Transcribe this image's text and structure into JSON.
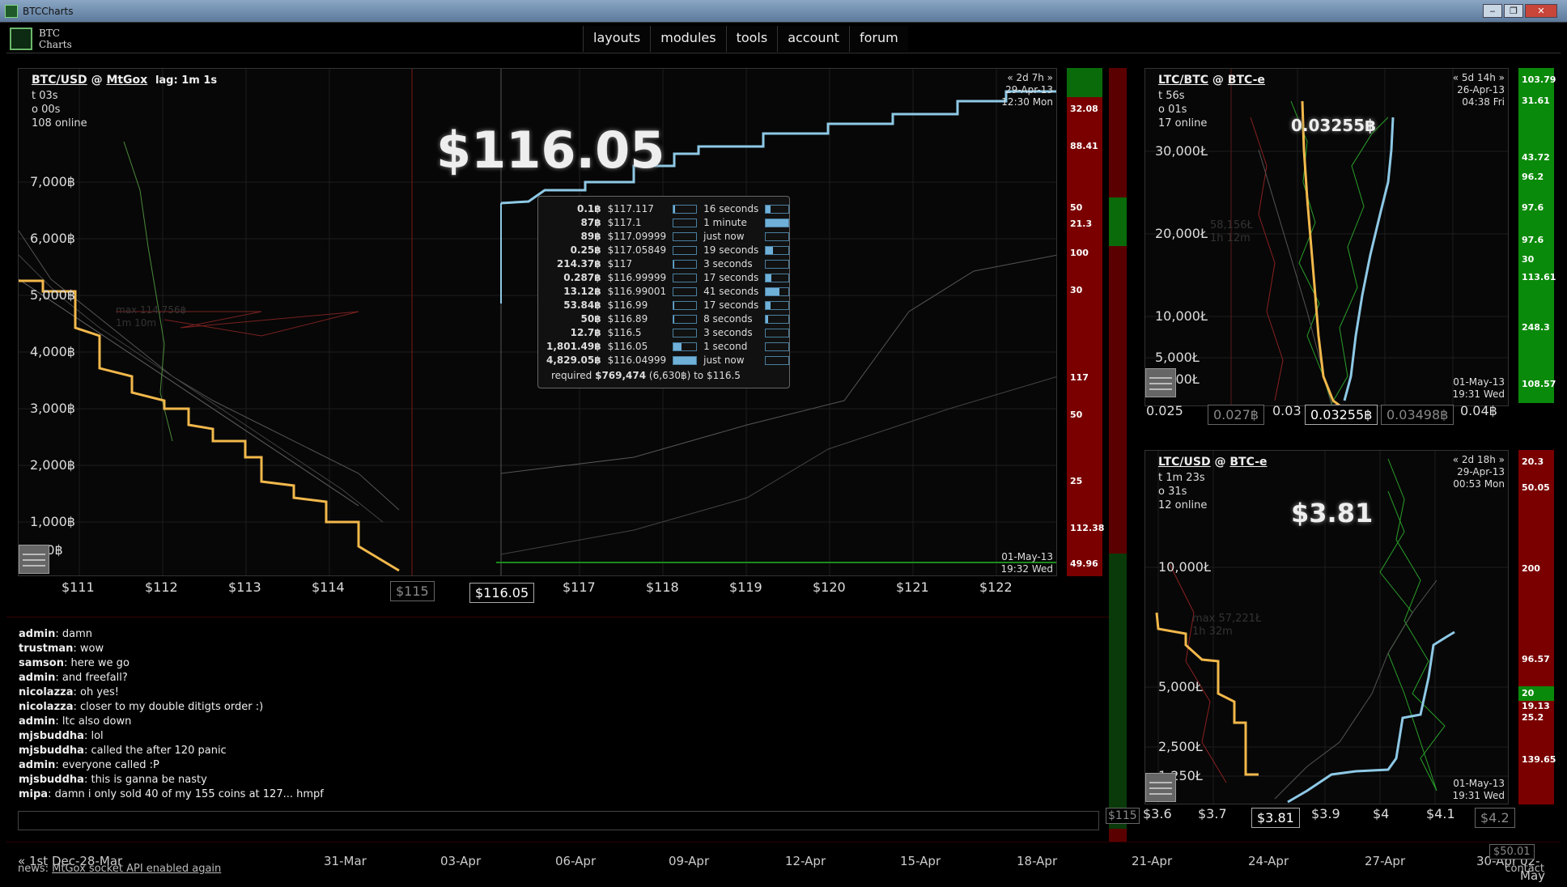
{
  "window": {
    "title": "BTCCharts",
    "buttons": [
      "‒",
      "❐",
      "✕"
    ]
  },
  "logo": {
    "line1": "BTC",
    "line2": "Charts"
  },
  "nav": [
    "layouts",
    "modules",
    "tools",
    "account",
    "forum"
  ],
  "btc": {
    "pair": "BTC/USD",
    "at": "@",
    "exchange": "MtGox",
    "lag": "lag: 1m 1s",
    "info": [
      "t 03s",
      "o 00s",
      "108 online"
    ],
    "price": "$116.05",
    "corner_top": [
      "« 2d 7h »",
      "29-Apr-13",
      "12:30 Mon"
    ],
    "corner_bottom": [
      "01-May-13",
      "19:32 Wed"
    ],
    "y_labels": [
      "7,000฿",
      "6,000฿",
      "5,000฿",
      "4,000฿",
      "3,000฿",
      "2,000฿",
      "1,000฿",
      "500฿"
    ],
    "x_labels": [
      "$111",
      "$112",
      "$113",
      "$114",
      "$117",
      "$118",
      "$119",
      "$120",
      "$121",
      "$122"
    ],
    "x_box_dim": "$115",
    "x_box": "$116.05",
    "ghost": [
      "max 114,756฿",
      "1m 10m"
    ],
    "sidebar": [
      "32.08",
      "88.41",
      "50",
      "21.3",
      "100",
      "30",
      "117",
      "50",
      "25",
      "112.38",
      "49.96"
    ]
  },
  "tooltip": {
    "rows": [
      {
        "amt": "0.1฿",
        "price": "$117.117",
        "time": "16 seconds",
        "fill": 0.05
      },
      {
        "amt": "87฿",
        "price": "$117.1",
        "time": "1 minute",
        "fill": 0.0
      },
      {
        "amt": "89฿",
        "price": "$117.09999",
        "time": "just now",
        "fill": 0.0
      },
      {
        "amt": "0.25฿",
        "price": "$117.05849",
        "time": "19 seconds",
        "fill": 0.0
      },
      {
        "amt": "214.37฿",
        "price": "$117",
        "time": "3 seconds",
        "fill": 0.04
      },
      {
        "amt": "0.287฿",
        "price": "$116.99999",
        "time": "17 seconds",
        "fill": 0.0
      },
      {
        "amt": "13.12฿",
        "price": "$116.99001",
        "time": "41 seconds",
        "fill": 0.0
      },
      {
        "amt": "53.84฿",
        "price": "$116.99",
        "time": "17 seconds",
        "fill": 0.01
      },
      {
        "amt": "50฿",
        "price": "$116.89",
        "time": "8 seconds",
        "fill": 0.01
      },
      {
        "amt": "12.7฿",
        "price": "$116.5",
        "time": "3 seconds",
        "fill": 0.0
      },
      {
        "amt": "1,801.49฿",
        "price": "$116.05",
        "time": "1 second",
        "fill": 0.37
      },
      {
        "amt": "4,829.05฿",
        "price": "$116.04999",
        "time": "just now",
        "fill": 1.0
      }
    ],
    "side_fill": [
      0.2,
      1.0,
      0.0,
      0.3,
      0.0,
      0.25,
      0.6,
      0.2,
      0.1,
      0.0,
      0.0,
      0.0
    ],
    "req_pre": "required ",
    "req_amt": "$769,474",
    "req_post": " (6,630฿) to $116.5"
  },
  "ltcbtc": {
    "pair": "LTC/BTC",
    "at": "@",
    "exchange": "BTC-e",
    "info": [
      "t 56s",
      "o 01s",
      "17 online"
    ],
    "price": "0.03255฿",
    "corner_top": [
      "« 5d 14h »",
      "26-Apr-13",
      "04:38 Fri"
    ],
    "corner_bottom": [
      "01-May-13",
      "19:31 Wed"
    ],
    "y_labels": [
      "30,000Ł",
      "20,000Ł",
      "10,000Ł",
      "5,000Ł",
      "2,500Ł"
    ],
    "x_labels": [
      "0.025",
      "0.03",
      "0.04฿"
    ],
    "x_box_dim1": "0.027฿",
    "x_box": "0.03255฿",
    "x_box_dim2": "0.03498฿",
    "ghost": [
      "58,156Ł",
      "1h 12m"
    ],
    "sidebar": [
      "103.79",
      "31.61",
      "43.72",
      "96.2",
      "97.6",
      "97.6",
      "30",
      "113.61",
      "248.3",
      "108.57"
    ]
  },
  "ltcusd": {
    "pair": "LTC/USD",
    "at": "@",
    "exchange": "BTC-e",
    "info": [
      "t 1m 23s",
      "o 31s",
      "12 online"
    ],
    "price": "$3.81",
    "corner_top": [
      "« 2d 18h »",
      "29-Apr-13",
      "00:53 Mon"
    ],
    "corner_bottom": [
      "01-May-13",
      "19:31 Wed"
    ],
    "y_labels": [
      "10,000Ł",
      "5,000Ł",
      "2,500Ł",
      "1,250Ł"
    ],
    "x_labels": [
      "$3.6",
      "$3.7",
      "$3.9",
      "$4",
      "$4.1"
    ],
    "x_box": "$3.81",
    "x_box_dim": "$4.2",
    "ghost": [
      "max 57,221Ł",
      "1h 32m"
    ],
    "sidebar": [
      "20.3",
      "50.05",
      "200",
      "96.57",
      "20",
      "19.13",
      "25.2",
      "139.65"
    ]
  },
  "chat": [
    {
      "user": "admin",
      "text": ": damn"
    },
    {
      "user": "trustman",
      "text": ": wow"
    },
    {
      "user": "samson",
      "text": ": here we go"
    },
    {
      "user": "admin",
      "text": ": and freefall?"
    },
    {
      "user": "nicolazza",
      "text": ": oh yes!"
    },
    {
      "user": "nicolazza",
      "text": ": closer to my double ditigts order :)"
    },
    {
      "user": "admin",
      "text": ": ltc also down"
    },
    {
      "user": "mjsbuddha",
      "text": ": lol"
    },
    {
      "user": "mjsbuddha",
      "text": ": called the after 120 panic"
    },
    {
      "user": "admin",
      "text": ": everyone called :P"
    },
    {
      "user": "mjsbuddha",
      "text": ": this is ganna be nasty"
    },
    {
      "user": "mipa",
      "text": ": damn i only sold 40 of my 155 coins at 127... hmpf"
    }
  ],
  "timeline": {
    "labels": [
      "« 1st Dec-28-Mar",
      "31-Mar",
      "03-Apr",
      "06-Apr",
      "09-Apr",
      "12-Apr",
      "15-Apr",
      "18-Apr",
      "21-Apr",
      "24-Apr",
      "27-Apr",
      "30-Apr",
      "02-May"
    ],
    "price_box": "$50.01",
    "side_stub": "$115"
  },
  "news": {
    "prefix": "news: ",
    "link": "MtGox socket API enabled again"
  },
  "contact": "contact",
  "colors": {
    "bid": "#f2b84b",
    "ask": "#8ec9e6",
    "accent_green": "#0a8a0a",
    "accent_red": "#8a0000"
  }
}
